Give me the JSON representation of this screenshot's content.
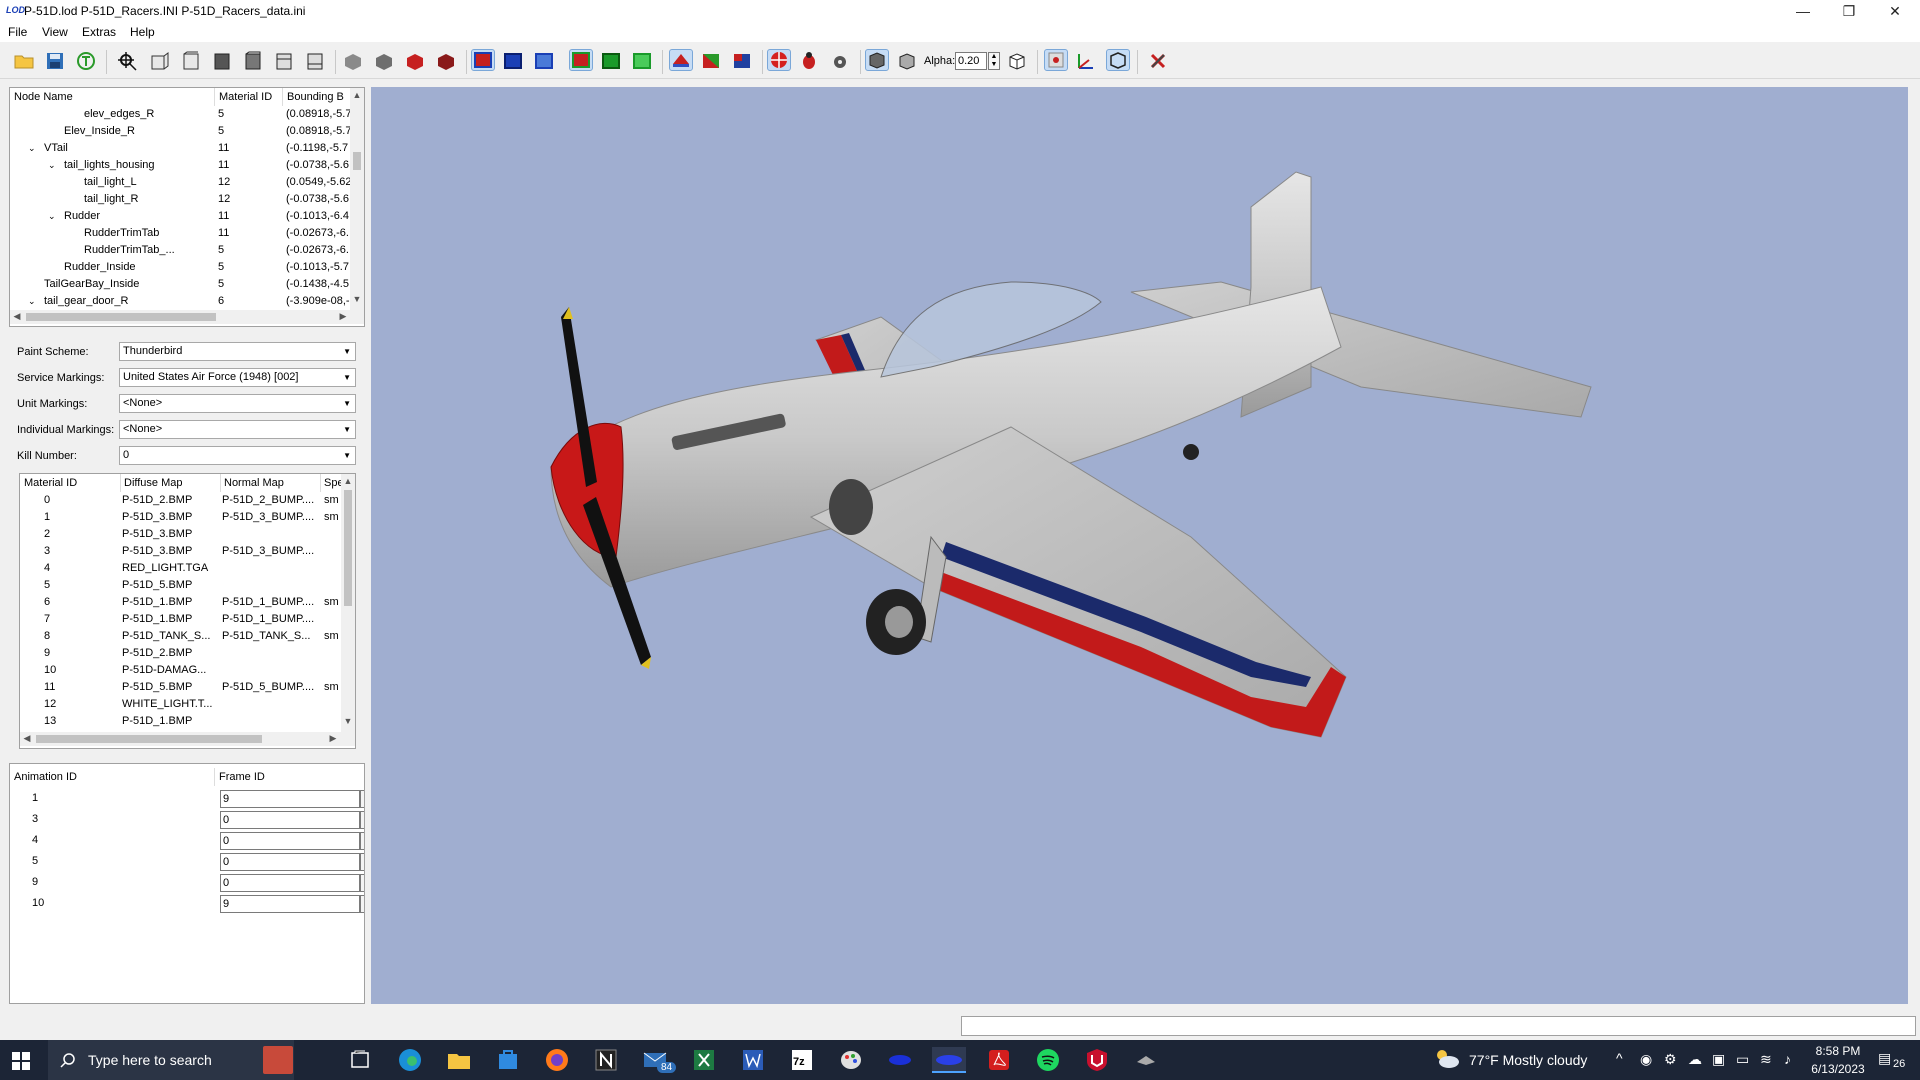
{
  "window": {
    "title": "P-51D.lod  P-51D_Racers.INI  P-51D_Racers_data.ini",
    "logo_text": "LOD",
    "controls": {
      "minimize": "—",
      "restore": "❐",
      "close": "✕"
    }
  },
  "menu": [
    "File",
    "View",
    "Extras",
    "Help"
  ],
  "toolbar": {
    "alpha_label": "Alpha:",
    "alpha_value": "0.20",
    "icons": [
      "open-folder-icon",
      "save-icon",
      "reload-icon",
      "zoom-fit-icon",
      "view-front-icon",
      "view-back-icon",
      "view-left-icon",
      "view-right-icon",
      "view-top-icon",
      "view-bottom-icon",
      "view-gray-1-icon",
      "view-gray-2-icon",
      "view-red-1-icon",
      "view-red-2-icon",
      "bbox-red-icon",
      "bbox-blue-icon",
      "bbox-blue-2-icon",
      "bbox-green-icon",
      "bbox-green-2-icon",
      "bbox-green-3-icon",
      "paint-icon",
      "texture-icon",
      "normals-icon",
      "target-icon",
      "bug-icon",
      "gear-icon",
      "cube-icon",
      "wire-cube-icon",
      "alpha-cube-icon",
      "grid-icon",
      "axes-icon",
      "box-icon",
      "tools-icon"
    ]
  },
  "node_tree": {
    "headers": [
      "Node Name",
      "Material ID",
      "Bounding B"
    ],
    "rows": [
      {
        "name": "elev_edges_R",
        "material": "5",
        "bbox": "(0.08918,-5.7",
        "indent": 3,
        "expander": ""
      },
      {
        "name": "Elev_Inside_R",
        "material": "5",
        "bbox": "(0.08918,-5.7",
        "indent": 2,
        "expander": ""
      },
      {
        "name": "VTail",
        "material": "11",
        "bbox": "(-0.1198,-5.7",
        "indent": 1,
        "expander": "v"
      },
      {
        "name": "tail_lights_housing",
        "material": "11",
        "bbox": "(-0.0738,-5.6",
        "indent": 2,
        "expander": "v"
      },
      {
        "name": "tail_light_L",
        "material": "12",
        "bbox": "(0.0549,-5.62",
        "indent": 3,
        "expander": ""
      },
      {
        "name": "tail_light_R",
        "material": "12",
        "bbox": "(-0.0738,-5.6",
        "indent": 3,
        "expander": ""
      },
      {
        "name": "Rudder",
        "material": "11",
        "bbox": "(-0.1013,-6.4",
        "indent": 2,
        "expander": "v"
      },
      {
        "name": "RudderTrimTab",
        "material": "11",
        "bbox": "(-0.02673,-6.",
        "indent": 3,
        "expander": ""
      },
      {
        "name": "RudderTrimTab_...",
        "material": "5",
        "bbox": "(-0.02673,-6.",
        "indent": 3,
        "expander": ""
      },
      {
        "name": "Rudder_Inside",
        "material": "5",
        "bbox": "(-0.1013,-5.7",
        "indent": 2,
        "expander": ""
      },
      {
        "name": "TailGearBay_Inside",
        "material": "5",
        "bbox": "(-0.1438,-4.5",
        "indent": 1,
        "expander": ""
      },
      {
        "name": "tail_gear_door_R",
        "material": "6",
        "bbox": "(-3.909e-08,-",
        "indent": 1,
        "expander": "v"
      }
    ]
  },
  "markings": {
    "paint_scheme_label": "Paint Scheme:",
    "paint_scheme": "Thunderbird",
    "service_label": "Service Markings:",
    "service": "United States Air Force (1948) [002]",
    "unit_label": "Unit Markings:",
    "unit": "<None>",
    "individual_label": "Individual Markings:",
    "individual": "<None>",
    "kill_label": "Kill Number:",
    "kill": "0"
  },
  "materials": {
    "headers": [
      "Material ID",
      "Diffuse Map",
      "Normal Map",
      "Spe"
    ],
    "rows": [
      {
        "id": "0",
        "diffuse": "P-51D_2.BMP",
        "normal": "P-51D_2_BUMP....",
        "spec": "sm"
      },
      {
        "id": "1",
        "diffuse": "P-51D_3.BMP",
        "normal": "P-51D_3_BUMP....",
        "spec": "sm"
      },
      {
        "id": "2",
        "diffuse": "P-51D_3.BMP",
        "normal": "",
        "spec": ""
      },
      {
        "id": "3",
        "diffuse": "P-51D_3.BMP",
        "normal": "P-51D_3_BUMP....",
        "spec": ""
      },
      {
        "id": "4",
        "diffuse": "RED_LIGHT.TGA",
        "normal": "",
        "spec": ""
      },
      {
        "id": "5",
        "diffuse": "P-51D_5.BMP",
        "normal": "",
        "spec": ""
      },
      {
        "id": "6",
        "diffuse": "P-51D_1.BMP",
        "normal": "P-51D_1_BUMP....",
        "spec": "sm"
      },
      {
        "id": "7",
        "diffuse": "P-51D_1.BMP",
        "normal": "P-51D_1_BUMP....",
        "spec": ""
      },
      {
        "id": "8",
        "diffuse": "P-51D_TANK_S...",
        "normal": "P-51D_TANK_S...",
        "spec": "sm"
      },
      {
        "id": "9",
        "diffuse": "P-51D_2.BMP",
        "normal": "",
        "spec": ""
      },
      {
        "id": "10",
        "diffuse": "P-51D-DAMAG...",
        "normal": "",
        "spec": ""
      },
      {
        "id": "11",
        "diffuse": "P-51D_5.BMP",
        "normal": "P-51D_5_BUMP....",
        "spec": "sm"
      },
      {
        "id": "12",
        "diffuse": "WHITE_LIGHT.T...",
        "normal": "",
        "spec": ""
      },
      {
        "id": "13",
        "diffuse": "P-51D_1.BMP",
        "normal": "",
        "spec": ""
      }
    ]
  },
  "animations": {
    "headers": [
      "Animation ID",
      "Frame ID"
    ],
    "rows": [
      {
        "id": "1",
        "frame": "9"
      },
      {
        "id": "3",
        "frame": "0"
      },
      {
        "id": "4",
        "frame": "0"
      },
      {
        "id": "5",
        "frame": "0"
      },
      {
        "id": "9",
        "frame": "0"
      },
      {
        "id": "10",
        "frame": "9"
      }
    ]
  },
  "viewport": {
    "background": "#a0aed0",
    "model": "P-51D aircraft in silver with red, white and blue Thunderbird markings"
  },
  "taskbar": {
    "search_placeholder": "Type here to search",
    "mail_badge": "84",
    "weather": "77°F  Mostly cloudy",
    "time": "8:58 PM",
    "date": "6/13/2023",
    "notification_count": "26",
    "apps": [
      "task-view-icon",
      "edge-icon",
      "file-explorer-icon",
      "store-icon",
      "firefox-icon",
      "notion-icon",
      "mail-icon",
      "excel-icon",
      "word-icon",
      "7zip-icon",
      "paint-icon",
      "app-blue-icon",
      "lod-viewer-icon",
      "acrobat-icon",
      "spotify-icon",
      "mcafee-icon",
      "game-icon"
    ]
  },
  "colors": {
    "accent": "#0078d7",
    "taskbar": "#1c2536",
    "viewport_bg": "#a0aed0",
    "red": "#cc1818",
    "navy": "#1b2a6b"
  }
}
